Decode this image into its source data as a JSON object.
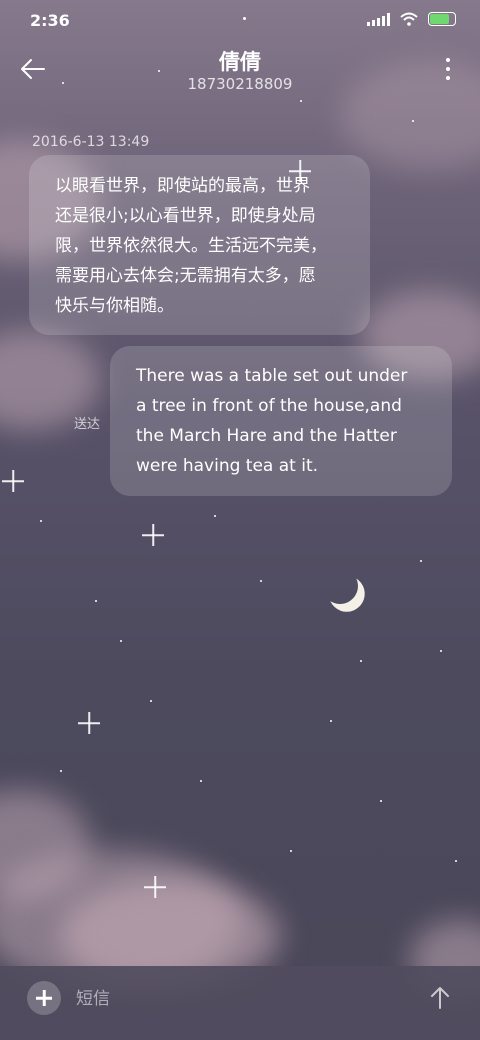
{
  "status_bar": {
    "time": "2:36",
    "battery_level": 0.85,
    "battery_color": "#6fd86f"
  },
  "header": {
    "back_icon": "arrow-left-icon",
    "contact_name": "倩倩",
    "contact_number": "18730218809",
    "menu_icon": "more-vertical-icon"
  },
  "conversation": {
    "timestamp": "2016-6-13 13:49",
    "received_message": {
      "lines": [
        "以眼看世界，即使站的最高，世界",
        "还是很小;以心看世界，即使身处局",
        "限，世界依然很大。生活远不完美，",
        "需要用心去体会;无需拥有太多，愿",
        "快乐与你相随。"
      ]
    },
    "sent_message": {
      "lines": [
        "There was a table set out under",
        "a tree in front of the house,and",
        "the March Hare and the Hatter",
        "were having tea at it."
      ],
      "status": "送达"
    }
  },
  "input_bar": {
    "add_icon": "plus-icon",
    "placeholder": "短信",
    "send_icon": "arrow-up-icon"
  }
}
